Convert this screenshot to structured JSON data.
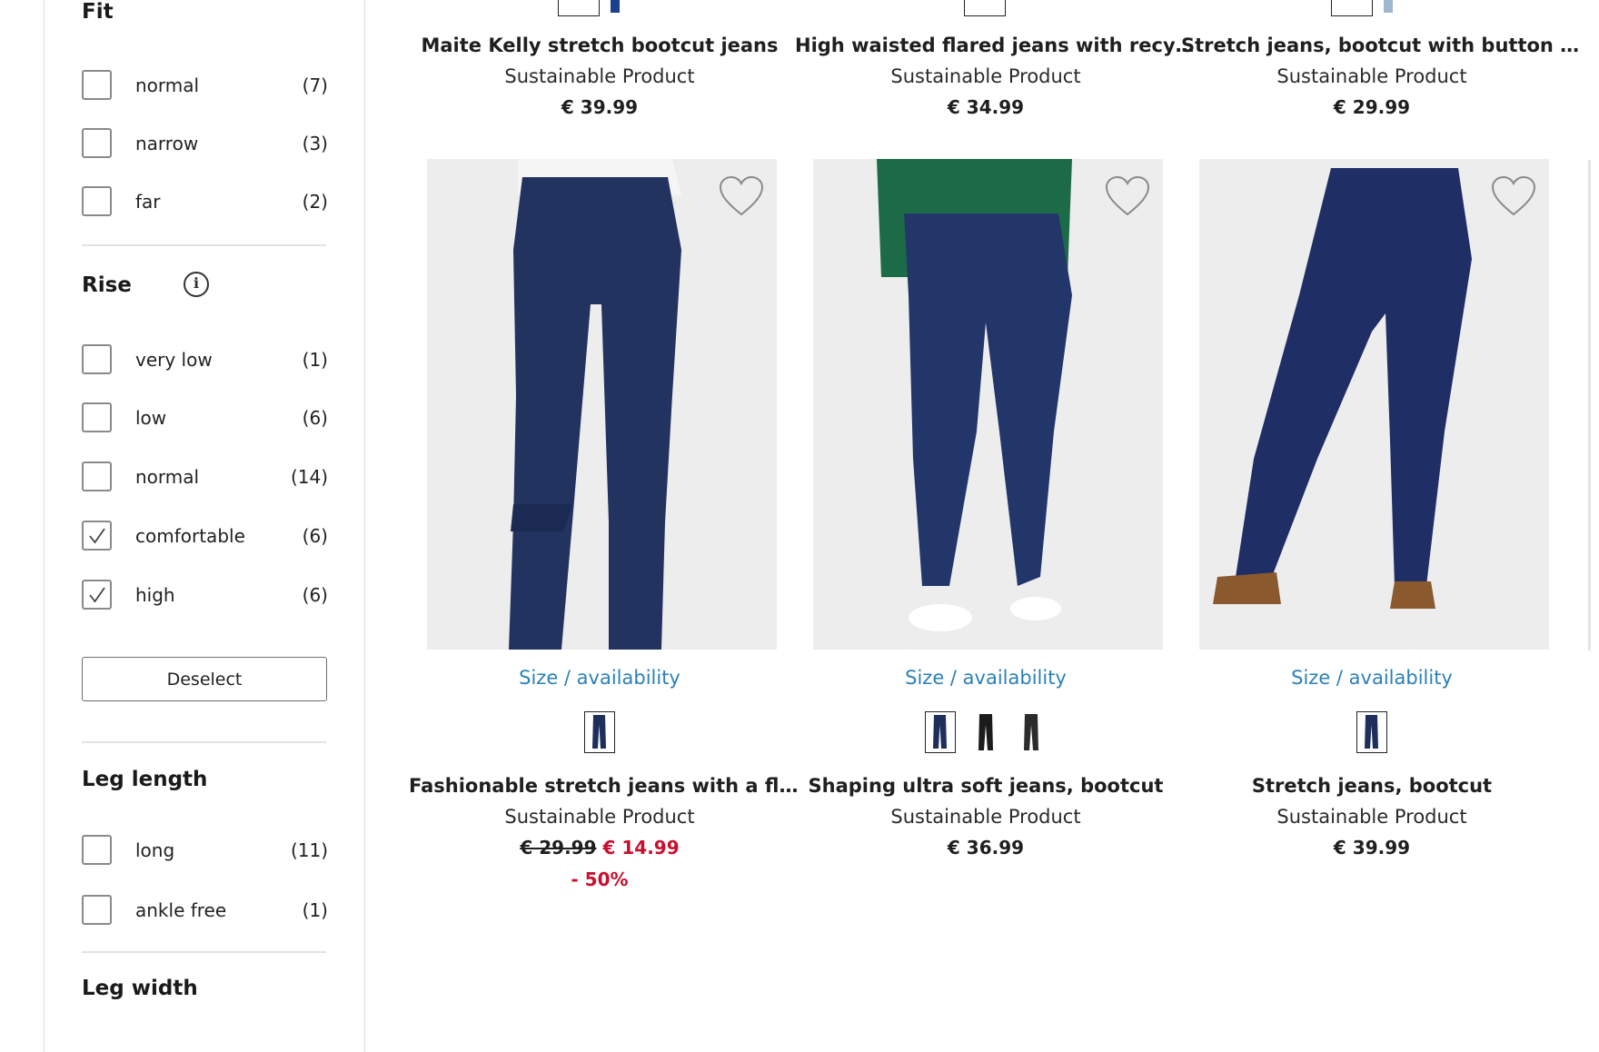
{
  "filters": {
    "fit": {
      "title": "Fit",
      "options": [
        {
          "label": "normal",
          "count": "(7)",
          "checked": false
        },
        {
          "label": "narrow",
          "count": "(3)",
          "checked": false
        },
        {
          "label": "far",
          "count": "(2)",
          "checked": false
        }
      ]
    },
    "rise": {
      "title": "Rise",
      "info_icon": "info-icon",
      "options": [
        {
          "label": "very low",
          "count": "(1)",
          "checked": false
        },
        {
          "label": "low",
          "count": "(6)",
          "checked": false
        },
        {
          "label": "normal",
          "count": "(14)",
          "checked": false
        },
        {
          "label": "comfortable",
          "count": "(6)",
          "checked": true
        },
        {
          "label": "high",
          "count": "(6)",
          "checked": true
        }
      ],
      "deselect_label": "Deselect"
    },
    "leg_length": {
      "title": "Leg length",
      "options": [
        {
          "label": "long",
          "count": "(11)",
          "checked": false
        },
        {
          "label": "ankle free",
          "count": "(1)",
          "checked": false
        }
      ]
    },
    "leg_width": {
      "title": "Leg width"
    }
  },
  "products_top": [
    {
      "name": "Maite Kelly stretch bootcut jeans",
      "subtitle": "Sustainable Product",
      "price": "€ 39.99"
    },
    {
      "name": "High waisted flared jeans with recy…",
      "subtitle": "Sustainable Product",
      "price": "€ 34.99"
    },
    {
      "name": "Stretch jeans, bootcut with button …",
      "subtitle": "Sustainable Product",
      "price": "€ 29.99"
    }
  ],
  "products": [
    {
      "size_link": "Size / availability",
      "name": "Fashionable stretch jeans with a fl…",
      "subtitle": "Sustainable Product",
      "old_price": "€ 29.99",
      "price": "€ 14.99",
      "discount": "- 50%",
      "swatch_count": 1
    },
    {
      "size_link": "Size / availability",
      "name": "Shaping ultra soft jeans, bootcut",
      "subtitle": "Sustainable Product",
      "price": "€ 36.99",
      "swatch_count": 3
    },
    {
      "size_link": "Size / availability",
      "name": "Stretch jeans, bootcut",
      "subtitle": "Sustainable Product",
      "price": "€ 39.99",
      "swatch_count": 1
    }
  ],
  "icons": {
    "wishlist": "heart-icon",
    "checkbox_checked": "check-icon",
    "info": "info-icon"
  },
  "colors": {
    "link": "#2b80b9",
    "sale": "#c8102e",
    "denim": "#1e2f5c"
  }
}
